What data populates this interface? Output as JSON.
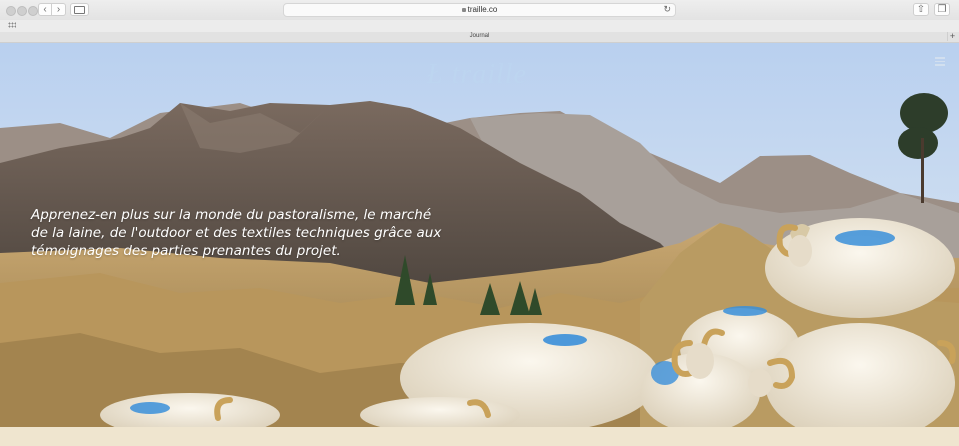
{
  "browser": {
    "url": "traille.co",
    "tab_title": "Journal",
    "new_tab_icon": "plus-icon",
    "nav_back_icon": "chevron-left-icon",
    "nav_forward_icon": "chevron-right-icon"
  },
  "hero": {
    "text": "Apprenez-en plus sur la monde du pastoralisme, le marché de la laine, de l'outdoor et des textiles techniques grâce aux témoignages des parties prenantes du projet."
  },
  "colors": {
    "sky": "#a9c6e8",
    "mountains": "#6d5f55",
    "grass": "#c9a66b",
    "sheep_wool": "#efe8d8",
    "sheep_mark": "#3a8fd9",
    "bottom_strip": "#efe5cf"
  }
}
